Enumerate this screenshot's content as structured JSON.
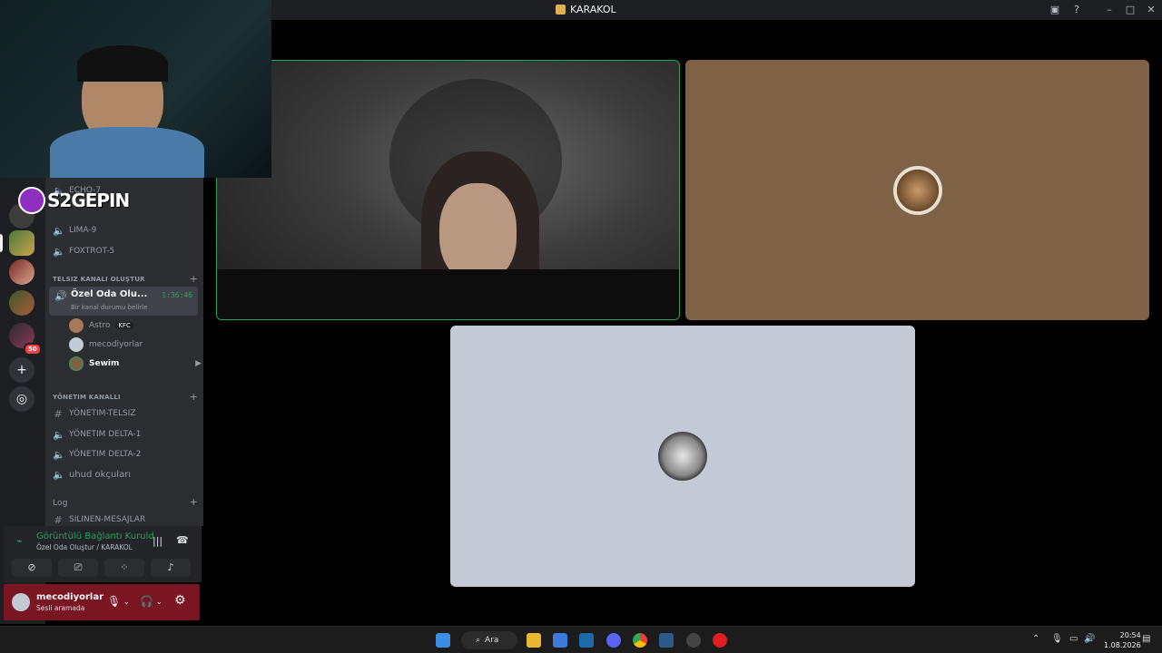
{
  "window": {
    "title": "KARAKOL"
  },
  "overlay": {
    "stream_logo_text": "S2GEPIN"
  },
  "rail": {
    "badge": "50"
  },
  "sidebar": {
    "channels_top": [
      {
        "name": "ECHO-7",
        "icon": "speaker-icon"
      },
      {
        "name": "LIMA-9",
        "icon": "speaker-icon"
      },
      {
        "name": "FOXTROT-5",
        "icon": "speaker-icon"
      }
    ],
    "category_telsiz": "TELSIZ KANALI OLUŞTUR",
    "active_channel": {
      "name": "Özel Oda Olu...",
      "timer": "1:36:46",
      "status_hint": "Bir kanal durumu belirle"
    },
    "voice_users": [
      {
        "name": "Astro",
        "tag": "KFC",
        "color": "#b5bac1"
      },
      {
        "name": "mecodiyorlar",
        "color": "#b5bac1"
      },
      {
        "name": "Sewim",
        "color": "#f2f3f5"
      }
    ],
    "category_yonetim": "YÖNETIM KANALLI",
    "channels_yonetim": [
      {
        "name": "YÖNETIM-TELSIZ",
        "icon": "hash-icon"
      },
      {
        "name": "YÖNETIM DELTA-1",
        "icon": "speaker-icon"
      },
      {
        "name": "YÖNETIM DELTA-2",
        "icon": "speaker-icon"
      },
      {
        "name": "uhud okçuları",
        "icon": "speaker-icon"
      }
    ],
    "category_log": "Log",
    "channels_log": [
      {
        "name": "SILINEN-MESAJLAR",
        "icon": "hash-icon"
      }
    ]
  },
  "voice_panel": {
    "status": "Görüntülü Bağlantı Kuruld",
    "location": "Özel Oda Oluştur / KARAKOL"
  },
  "user": {
    "name": "mecodiyorlar",
    "status": "Sesli aramada"
  },
  "taskbar": {
    "search_label": "Ara",
    "time": "20:54",
    "date": "1.08.2026"
  },
  "colors": {
    "accent_green": "#23a55a",
    "tile_brown": "#7f6245",
    "tile_grey": "#c3cad6",
    "userbar": "#7a1622"
  }
}
